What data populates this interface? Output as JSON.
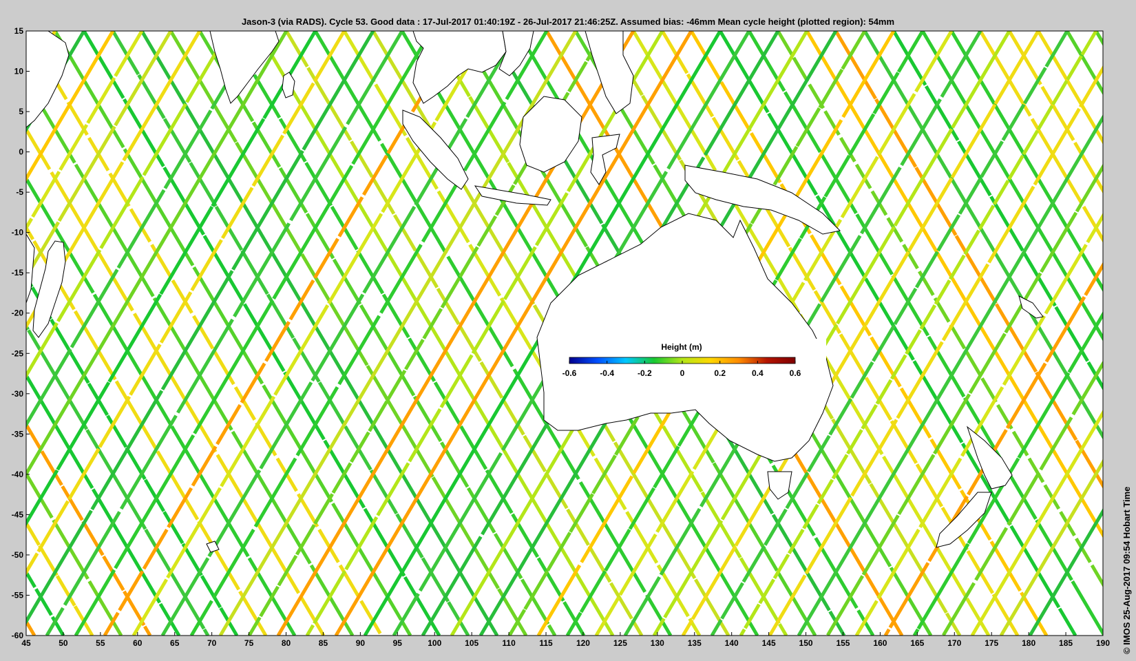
{
  "title": "Jason-3 (via RADS). Cycle 53. Good data : 17-Jul-2017 01:40:19Z - 26-Jul-2017 21:46:25Z. Assumed bias: -46mm  Mean cycle height (plotted region): 54mm",
  "credit": "©  IMOS 25-Aug-2017 09:54 Hobart Time",
  "map": {
    "lon_range": [
      45,
      190
    ],
    "lat_range": [
      -60,
      15
    ],
    "x_ticks": [
      "45",
      "50",
      "55",
      "60",
      "65",
      "70",
      "75",
      "80",
      "85",
      "90",
      "95",
      "100",
      "105",
      "110",
      "115",
      "120",
      "125",
      "130",
      "135",
      "140",
      "145",
      "150",
      "155",
      "160",
      "165",
      "170",
      "175",
      "180",
      "185",
      "190"
    ],
    "y_ticks": [
      "15",
      "10",
      "5",
      "0",
      "-5",
      "-10",
      "-15",
      "-20",
      "-25",
      "-30",
      "-35",
      "-40",
      "-45",
      "-50",
      "-55",
      "-60"
    ]
  },
  "colorbar": {
    "title": "Height (m)",
    "range": [
      -0.6,
      0.6
    ],
    "ticks": [
      "-0.6",
      "-0.4",
      "-0.2",
      "0",
      "0.2",
      "0.4",
      "0.6"
    ],
    "colors": [
      "#00008f",
      "#0050ff",
      "#00c8ff",
      "#19c832",
      "#b4e619",
      "#ffd700",
      "#ff8c00",
      "#b41400",
      "#7f0000"
    ]
  },
  "land_color": "#ffffff",
  "coast_color": "#000000"
}
